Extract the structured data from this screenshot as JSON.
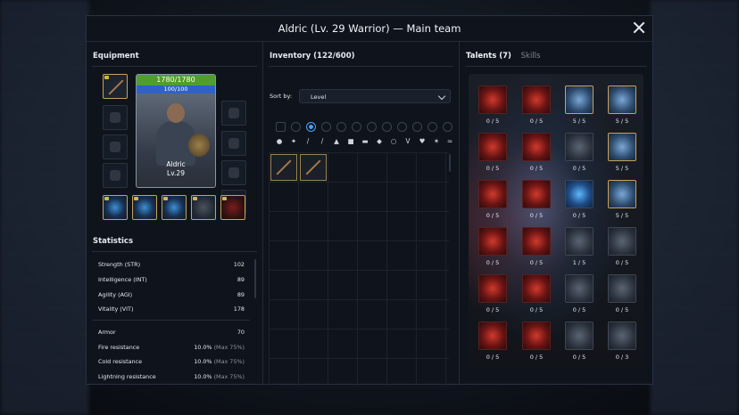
{
  "window": {
    "title": "Aldric (Lv. 29 Warrior) — Main team"
  },
  "equipment": {
    "heading": "Equipment",
    "portrait": {
      "hp": "1780/1780",
      "mp": "100/100",
      "name": "Aldric",
      "level": "Lv.29"
    }
  },
  "statistics": {
    "heading": "Statistics",
    "rows": [
      {
        "label": "Strength (STR)",
        "value": "102"
      },
      {
        "label": "Intelligence (INT)",
        "value": "89"
      },
      {
        "label": "Agility (AGI)",
        "value": "89"
      },
      {
        "label": "Vitality (VIT)",
        "value": "178"
      },
      {
        "label": "Armor",
        "value": "70"
      },
      {
        "label": "Fire resistance",
        "value": "10.0%",
        "max": "(Max 75%)"
      },
      {
        "label": "Cold resistance",
        "value": "10.0%",
        "max": "(Max 75%)"
      },
      {
        "label": "Lightning resistance",
        "value": "10.0%",
        "max": "(Max 75%)"
      }
    ]
  },
  "inventory": {
    "heading": "Inventory (122/600)",
    "sort_label": "Sort by:",
    "sort_value": "Level"
  },
  "talents": {
    "tab_active": "Talents (7)",
    "tab_other": "Skills",
    "counts": [
      [
        "0 / 5",
        "0 / 5",
        "5 / 5",
        "5 / 5"
      ],
      [
        "0 / 5",
        "0 / 5",
        "0 / 5",
        "5 / 5"
      ],
      [
        "0 / 5",
        "0 / 5",
        "0 / 5",
        "5 / 5"
      ],
      [
        "0 / 5",
        "0 / 5",
        "1 / 5",
        "0 / 5"
      ],
      [
        "0 / 5",
        "0 / 5",
        "0 / 5",
        "0 / 5"
      ],
      [
        "0 / 5",
        "0 / 5",
        "0 / 5",
        "0 / 3"
      ]
    ]
  }
}
